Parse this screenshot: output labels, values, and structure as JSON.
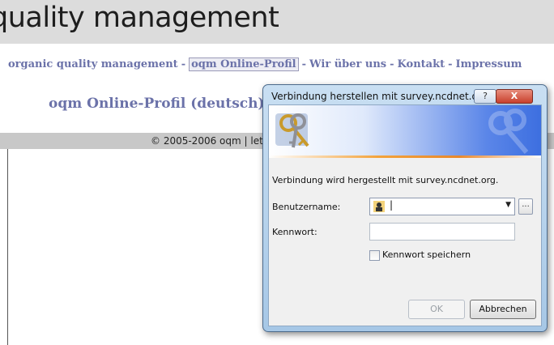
{
  "site": {
    "title": "quality management",
    "nav": {
      "item1": "organic quality management",
      "item2": "oqm Online-Profil",
      "item3": "Wir über uns",
      "item4": "Kontakt",
      "item5": "Impressum",
      "separator": "-"
    },
    "heading": "oqm Online-Profil (deutsch)",
    "footer": "© 2005-2006 oqm | let"
  },
  "dialog": {
    "title": "Verbindung herstellen mit survey.ncdnet.org",
    "help_label": "?",
    "close_label": "X",
    "message": "Verbindung wird hergestellt mit survey.ncdnet.org.",
    "username_label": "Benutzername:",
    "username_value": "|",
    "password_label": "Kennwort:",
    "remember_label": "Kennwort speichern",
    "remember_checked": false,
    "ok_label": "OK",
    "cancel_label": "Abbrechen",
    "browse_label": "...",
    "combo_arrow": "▼"
  },
  "icons": {
    "keys": "keys-icon",
    "user": "user-avatar-icon"
  },
  "colors": {
    "nav_link": "#6b72a9",
    "dialog_frame": "#a6c7e6",
    "banner_accent": "#3d6fe0",
    "close_button": "#c8402c"
  }
}
